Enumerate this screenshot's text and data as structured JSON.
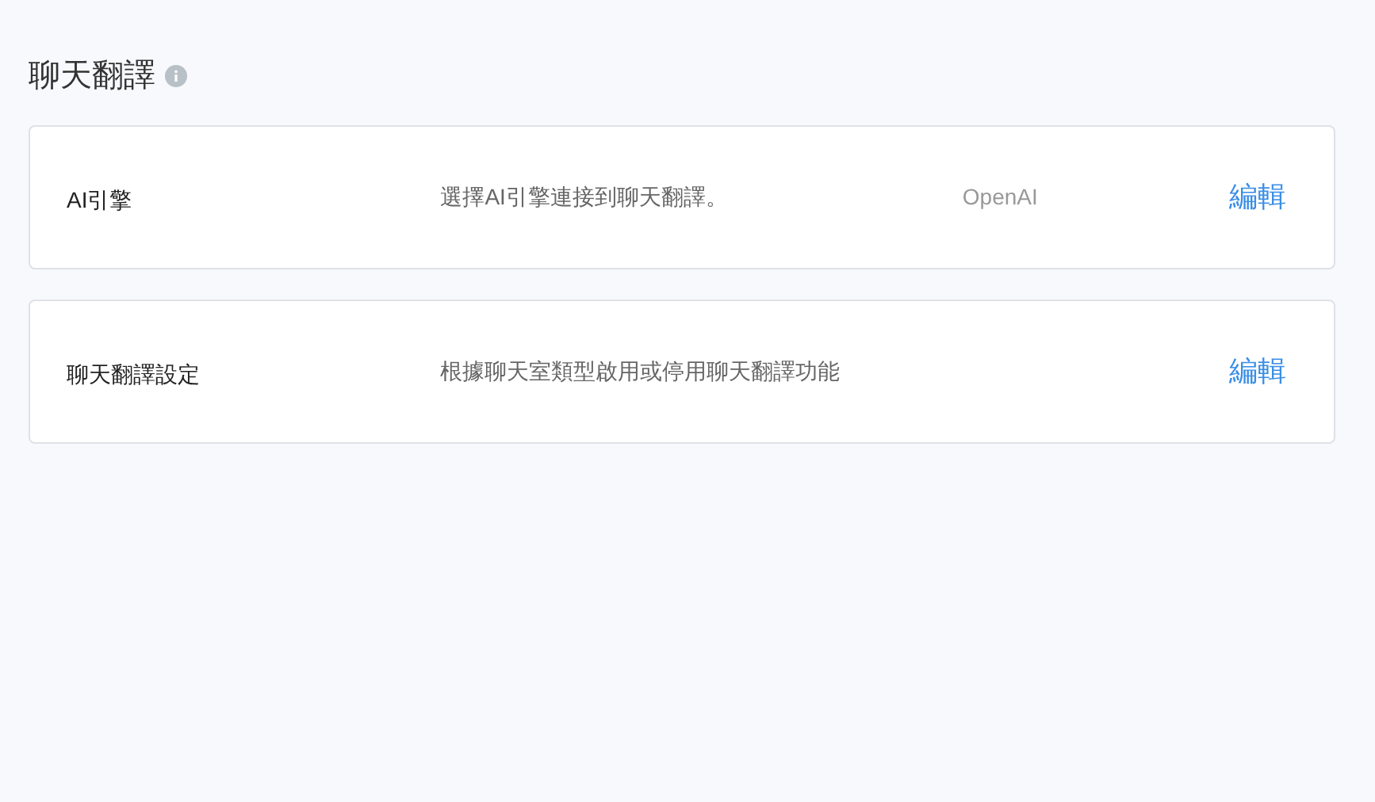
{
  "title": "聊天翻譯",
  "settings": [
    {
      "label": "AI引擎",
      "description": "選擇AI引擎連接到聊天翻譯。",
      "value": "OpenAI",
      "action": "編輯"
    },
    {
      "label": "聊天翻譯設定",
      "description": "根據聊天室類型啟用或停用聊天翻譯功能",
      "action": "編輯"
    }
  ]
}
